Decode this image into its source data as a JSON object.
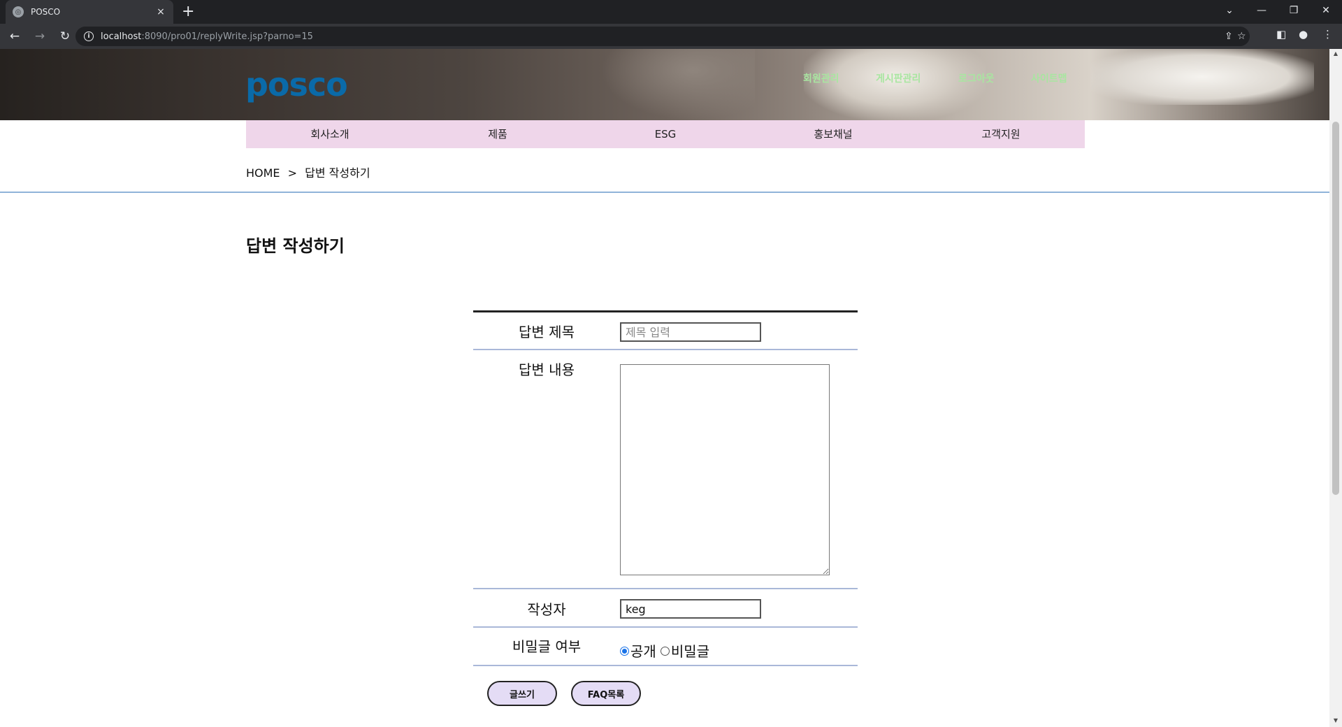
{
  "browser": {
    "tab_title": "POSCO",
    "tab_close": "×",
    "new_tab": "+",
    "url_host": "localhost",
    "url_rest": ":8090/pro01/replyWrite.jsp?parno=15",
    "window_controls": {
      "dropdown": "⌄",
      "minimize": "—",
      "restore": "❐",
      "close": "✕"
    },
    "nav": {
      "back": "←",
      "forward": "→",
      "reload": "↻"
    },
    "icons": {
      "info": "i",
      "share": "⇪",
      "star": "☆",
      "sidepanel": "◧",
      "profile": "●",
      "menu": "⋮"
    }
  },
  "site": {
    "logo": "posco",
    "util_nav": [
      "회원관리",
      "게시판관리",
      "로그아웃",
      "사이트맵"
    ],
    "gnb": [
      "회사소개",
      "제품",
      "ESG",
      "홍보채널",
      "고객지원"
    ]
  },
  "breadcrumb": {
    "home": "HOME",
    "sep": ">",
    "current": "답변 작성하기"
  },
  "page_title": "답변 작성하기",
  "form": {
    "title_label": "답변 제목",
    "title_placeholder": "제목 입력",
    "content_label": "답변 내용",
    "author_label": "작성자",
    "author_value": "keg",
    "secret_label": "비밀글 여부",
    "secret_options": [
      "공개",
      "비밀글"
    ],
    "secret_selected": "공개"
  },
  "buttons": {
    "write": "글쓰기",
    "faq_list": "FAQ목록"
  },
  "colors": {
    "gnb_bg": "#efd6ea",
    "logo": "#0a6aa8",
    "util_nav": "#a8e6a0",
    "divider": "#8fb3d9",
    "button_bg": "#e4dcf5"
  }
}
